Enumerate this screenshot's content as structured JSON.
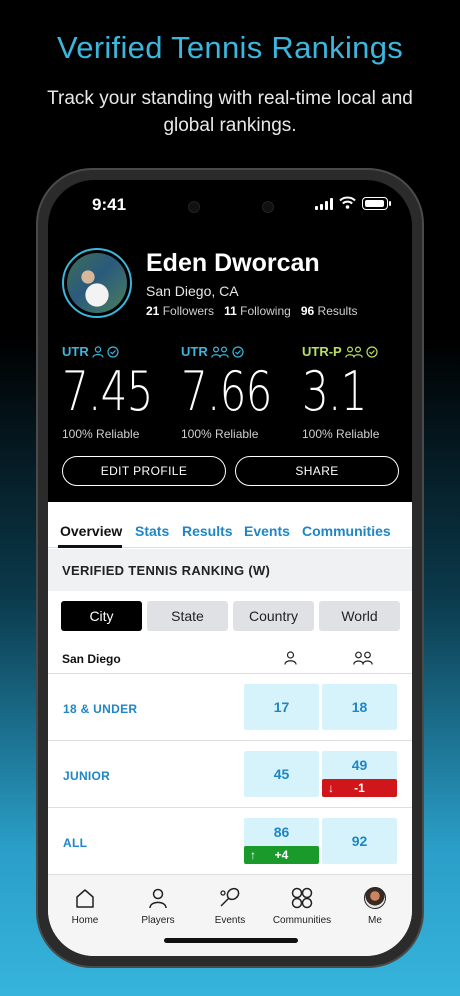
{
  "headline": "Verified Tennis Rankings",
  "subline": "Track your standing with real-time local and global rankings.",
  "status": {
    "time": "9:41"
  },
  "profile": {
    "name": "Eden Dworcan",
    "location": "San Diego, CA",
    "followers_count": "21",
    "followers_label": "Followers",
    "following_count": "11",
    "following_label": "Following",
    "results_count": "96",
    "results_label": "Results"
  },
  "ratings": [
    {
      "label": "UTR",
      "value": "7.45",
      "reliability": "100% Reliable",
      "color": "#3bb6dd"
    },
    {
      "label": "UTR",
      "value": "7.66",
      "reliability": "100% Reliable",
      "color": "#3bb6dd"
    },
    {
      "label": "UTR-P",
      "value": "3.1",
      "reliability": "100% Reliable",
      "color": "#b7e063"
    }
  ],
  "buttons": {
    "edit": "EDIT PROFILE",
    "share": "SHARE"
  },
  "tabs": [
    "Overview",
    "Stats",
    "Results",
    "Events",
    "Communities"
  ],
  "section_title": "VERIFIED TENNIS RANKING (W)",
  "scopes": [
    "City",
    "State",
    "Country",
    "World"
  ],
  "table": {
    "city": "San Diego",
    "rows": [
      {
        "label": "18 & UNDER",
        "singles": "17",
        "doubles": "18"
      },
      {
        "label": "JUNIOR",
        "singles": "45",
        "doubles": "49",
        "doubles_change": "-1"
      },
      {
        "label": "ALL",
        "singles": "86",
        "singles_change": "+4",
        "doubles": "92"
      }
    ]
  },
  "nav": [
    "Home",
    "Players",
    "Events",
    "Communities",
    "Me"
  ],
  "colors": {
    "accent": "#3bb6dd",
    "link": "#1f86c4",
    "utr_p": "#b7e063",
    "down": "#d0161a",
    "up": "#1b9a2c"
  }
}
